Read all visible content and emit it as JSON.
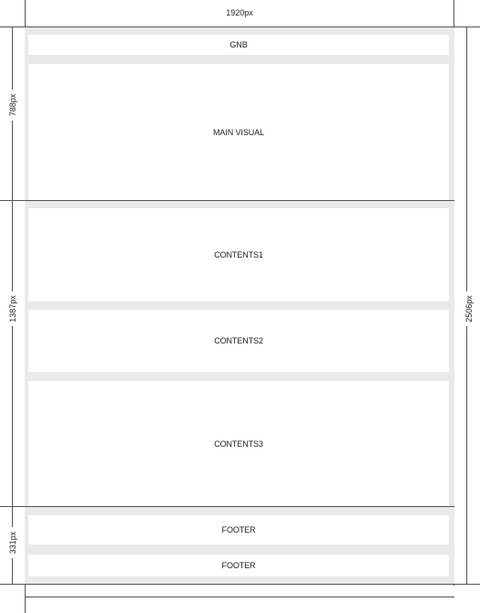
{
  "dimensions": {
    "width_label": "1920px",
    "section1_height_label": "788px",
    "section2_height_label": "1387px",
    "section3_height_label": "331px",
    "total_height_label": "2506px"
  },
  "blocks": {
    "gnb": "GNB",
    "main_visual": "MAIN VISUAL",
    "contents1": "CONTENTS1",
    "contents2": "CONTENTS2",
    "contents3": "CONTENTS3",
    "footer1": "FOOTER",
    "footer2": "FOOTER"
  },
  "colors": {
    "canvas_bg": "#e8e9e8",
    "block_bg": "#ffffff",
    "guide_line": "#555555"
  }
}
